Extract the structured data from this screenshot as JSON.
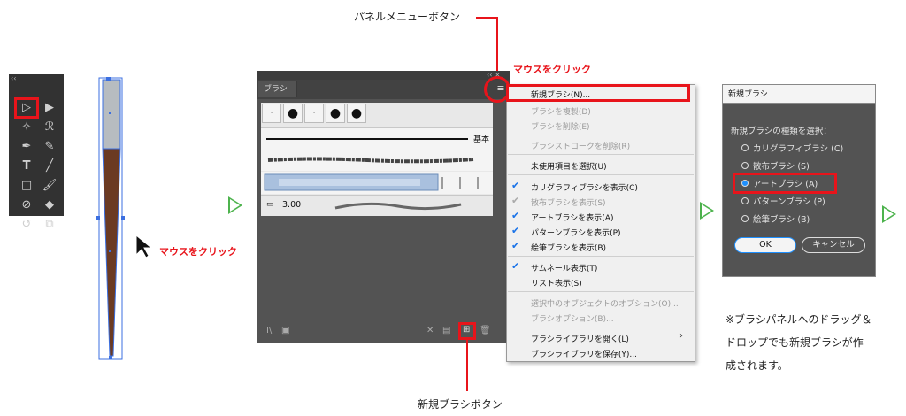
{
  "annotations": {
    "panel_menu_button": "パネルメニューボタン",
    "mouse_click_1": "マウスをクリック",
    "mouse_click_2": "マウスをクリック",
    "new_brush_button": "新規ブラシボタン",
    "note_line1": "※ブラシパネルへのドラッグ＆",
    "note_line2": "ドロップでも新規ブラシが作",
    "note_line3": "成されます。"
  },
  "brush_panel": {
    "tab_label": "ブラシ",
    "basic_label": "基本",
    "size_value": "3.00"
  },
  "menu": {
    "items": [
      {
        "label": "新規ブラシ(N)...",
        "checked": false,
        "disabled": false
      },
      {
        "label": "ブラシを複製(D)",
        "checked": false,
        "disabled": true
      },
      {
        "label": "ブラシを削除(E)",
        "checked": false,
        "disabled": true
      },
      {
        "label": "ブラシストロークを削除(R)",
        "checked": false,
        "disabled": true
      },
      {
        "label": "未使用項目を選択(U)",
        "checked": false,
        "disabled": false
      },
      {
        "label": "カリグラフィブラシを表示(C)",
        "checked": true,
        "disabled": false
      },
      {
        "label": "散布ブラシを表示(S)",
        "checked": true,
        "disabled": true
      },
      {
        "label": "アートブラシを表示(A)",
        "checked": true,
        "disabled": false
      },
      {
        "label": "パターンブラシを表示(P)",
        "checked": true,
        "disabled": false
      },
      {
        "label": "絵筆ブラシを表示(B)",
        "checked": true,
        "disabled": false
      },
      {
        "label": "サムネール表示(T)",
        "checked": true,
        "disabled": false
      },
      {
        "label": "リスト表示(S)",
        "checked": false,
        "disabled": false
      },
      {
        "label": "選択中のオブジェクトのオプション(O)...",
        "checked": false,
        "disabled": true
      },
      {
        "label": "ブラシオプション(B)...",
        "checked": false,
        "disabled": true
      },
      {
        "label": "ブラシライブラリを開く(L)",
        "checked": false,
        "disabled": false
      },
      {
        "label": "ブラシライブラリを保存(Y)...",
        "checked": false,
        "disabled": false
      }
    ]
  },
  "dialog": {
    "title": "新規ブラシ",
    "prompt": "新規ブラシの種類を選択：",
    "options": [
      {
        "label": "カリグラフィブラシ (C)",
        "selected": false
      },
      {
        "label": "散布ブラシ (S)",
        "selected": false
      },
      {
        "label": "アートブラシ (A)",
        "selected": true
      },
      {
        "label": "パターンブラシ (P)",
        "selected": false
      },
      {
        "label": "絵筆ブラシ (B)",
        "selected": false
      }
    ],
    "ok_label": "OK",
    "cancel_label": "キャンセル"
  },
  "colors": {
    "highlight": "#e8141b",
    "arrow": "#4db34d",
    "panel_bg": "#535353",
    "brush_fill": "#6b3a22"
  }
}
